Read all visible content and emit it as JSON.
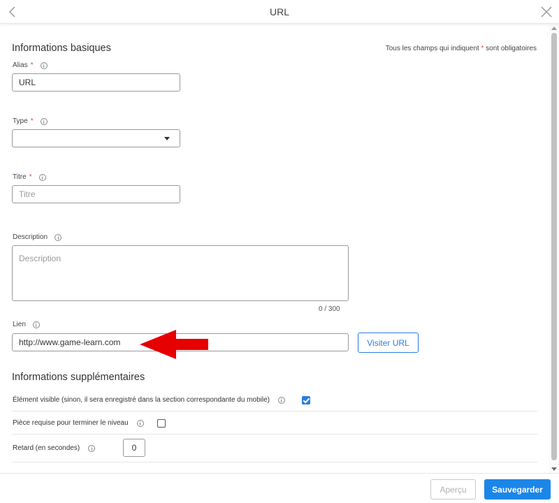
{
  "header": {
    "title": "URL",
    "back_icon": "chevron-left-icon",
    "close_icon": "close-icon"
  },
  "basic": {
    "section_title": "Informations basiques",
    "required_note_prefix": "Tous les champs qui indiquent",
    "required_note_star": "*",
    "required_note_suffix": "sont obligatoires",
    "alias": {
      "label": "Alias",
      "star": "*",
      "value": "URL"
    },
    "type": {
      "label": "Type",
      "star": "*",
      "value": ""
    },
    "titre": {
      "label": "Titre",
      "star": "*",
      "placeholder": "Titre"
    },
    "description": {
      "label": "Description",
      "placeholder": "Description",
      "counter": "0 / 300"
    },
    "lien": {
      "label": "Lien",
      "value": "http://www.game-learn.com",
      "visit_button": "Visiter URL"
    }
  },
  "extra": {
    "section_title": "Informations supplémentaires",
    "visible": {
      "label": "Élément visible (sinon, il sera enregistré dans la section correspondante du mobile)",
      "checked": true
    },
    "piece": {
      "label": "Pièce requise pour terminer le niveau",
      "checked": false
    },
    "retard": {
      "label": "Retard (en secondes)",
      "value": "0"
    }
  },
  "footer": {
    "preview_button": "Aperçu",
    "save_button": "Sauvegarder"
  },
  "colors": {
    "accent": "#1b86e8",
    "required": "#e8453c",
    "arrow": "#e60000"
  }
}
